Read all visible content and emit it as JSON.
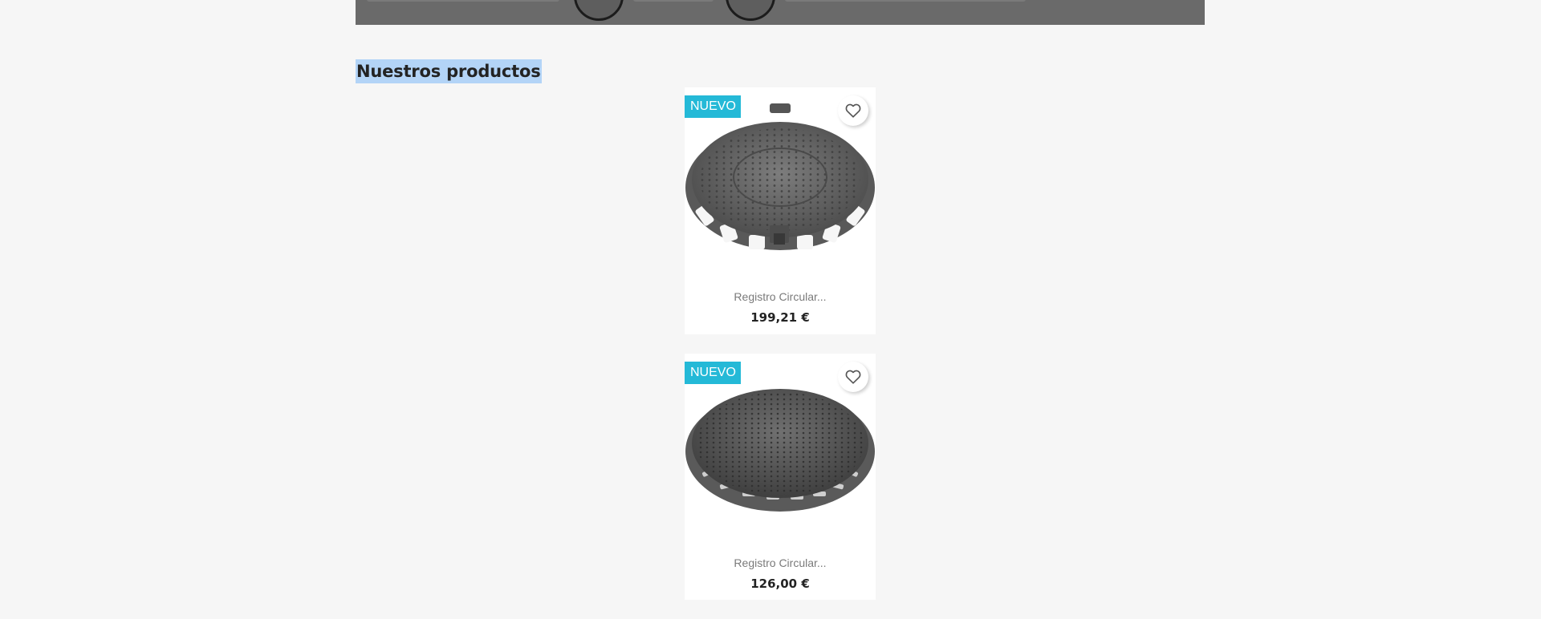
{
  "banner": {
    "badges": [
      "badge-icon",
      "badge-icon"
    ]
  },
  "section": {
    "title": "Nuestros productos"
  },
  "products": [
    {
      "flag": "NUEVO",
      "name": "Registro Circular...",
      "price": "199,21 €",
      "image_icon": "manhole-cover-hinged-image",
      "wishlist_icon": "heart-outline-icon"
    },
    {
      "flag": "NUEVO",
      "name": "Registro Circular...",
      "price": "126,00 €",
      "image_icon": "manhole-cover-round-image",
      "wishlist_icon": "heart-outline-icon"
    }
  ],
  "colors": {
    "page_bg": "#f6f6f6",
    "flag_bg": "#24b9d7",
    "title_highlight": "#b3d4f7",
    "banner_bg": "#6a6a6a"
  }
}
